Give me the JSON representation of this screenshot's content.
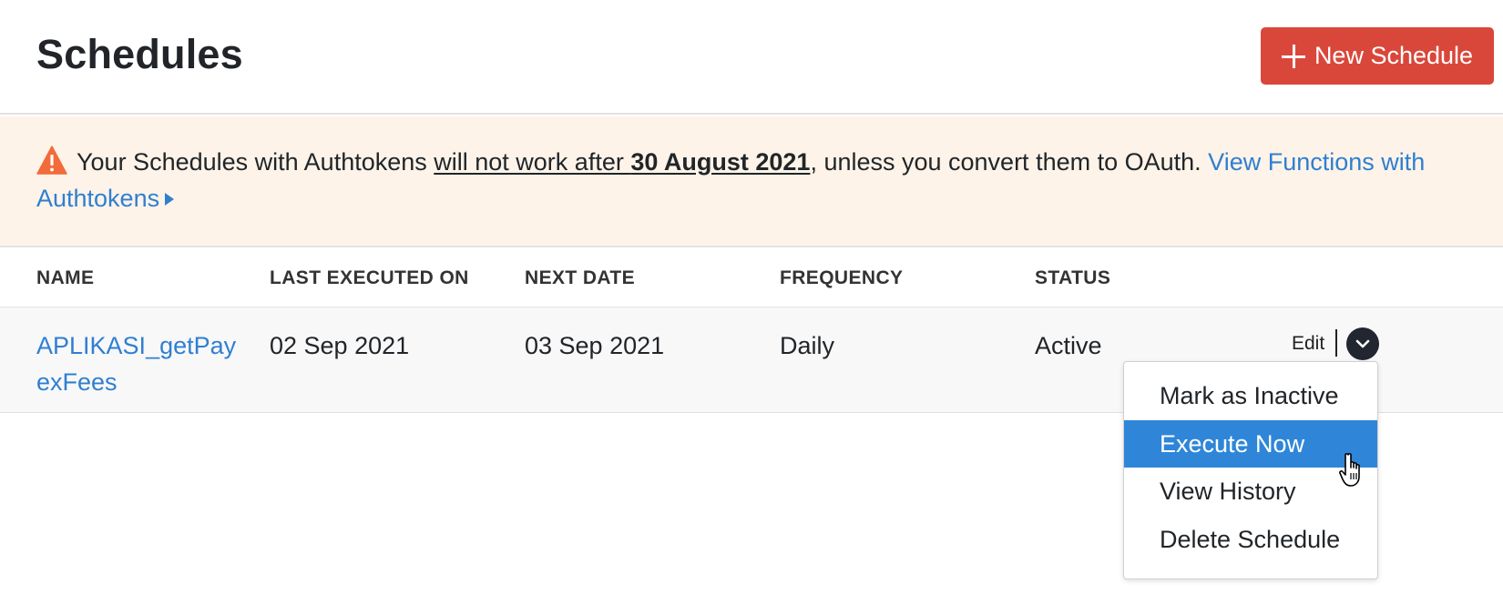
{
  "header": {
    "title": "Schedules",
    "new_button_label": "New Schedule",
    "accent_color": "#d9473a"
  },
  "banner": {
    "text_before": "Your Schedules with Authtokens ",
    "underlined_before_bold": "will not work after ",
    "underlined_bold": "30 August 2021",
    "text_after": ", unless you convert them to OAuth. ",
    "link_label": "View Functions with Authtokens",
    "background_color": "#fdf3e8",
    "icon": "warning-icon"
  },
  "table": {
    "columns": [
      "NAME",
      "LAST EXECUTED ON",
      "NEXT DATE",
      "FREQUENCY",
      "STATUS"
    ],
    "rows": [
      {
        "name": "APLIKASI_getPayexFees",
        "last_executed_on": "02 Sep 2021",
        "next_date": "03 Sep 2021",
        "frequency": "Daily",
        "status": "Active",
        "edit_label": "Edit"
      }
    ]
  },
  "row_menu": {
    "items": [
      "Mark as Inactive",
      "Execute Now",
      "View History",
      "Delete Schedule"
    ],
    "highlighted": "Execute Now",
    "highlight_color": "#2f86d8"
  },
  "link_color": "#2f7fd1"
}
